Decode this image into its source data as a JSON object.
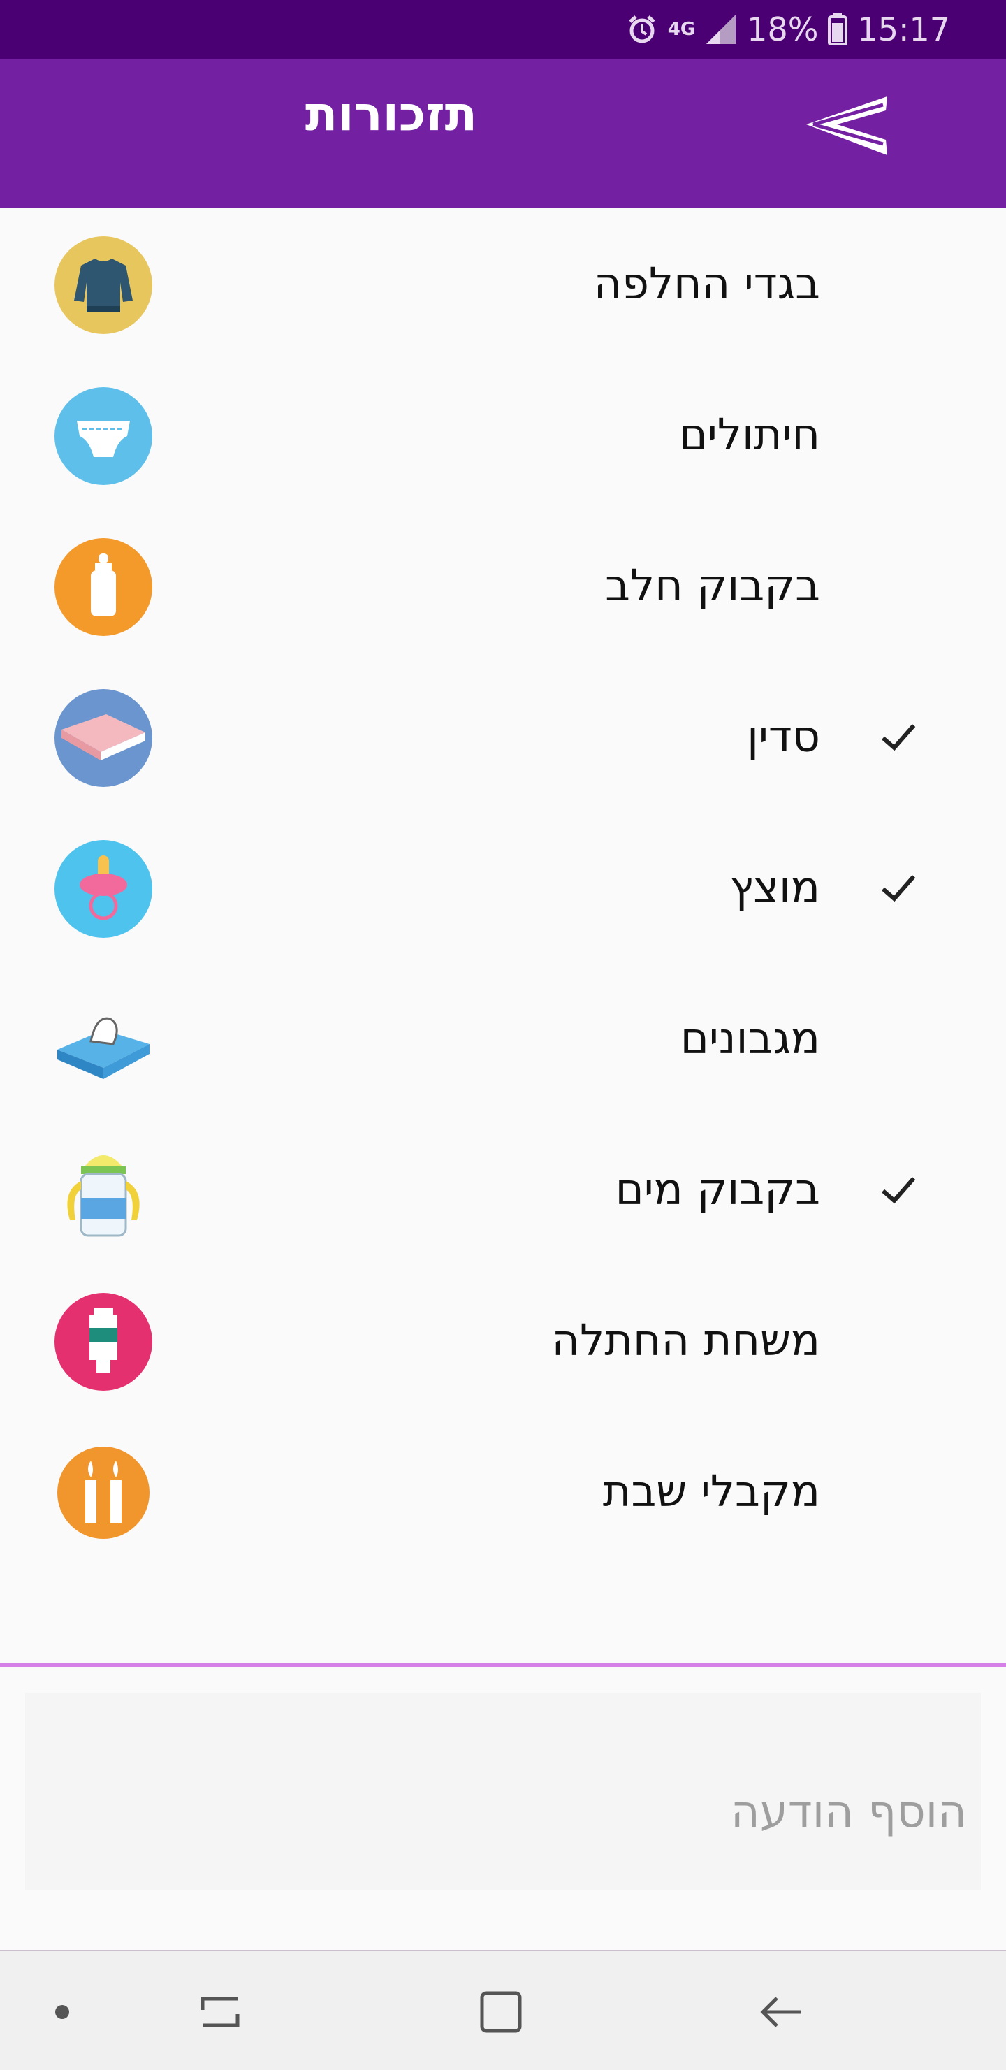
{
  "status_bar": {
    "network": "4G",
    "battery": "18%",
    "time": "15:17"
  },
  "app_bar": {
    "title": "תזכורות"
  },
  "items": [
    {
      "label": "בגדי החלפה",
      "checked": false,
      "icon": "sweater-icon"
    },
    {
      "label": "חיתולים",
      "checked": false,
      "icon": "diaper-icon"
    },
    {
      "label": "בקבוק חלב",
      "checked": false,
      "icon": "milk-bottle-icon"
    },
    {
      "label": "סדין",
      "checked": true,
      "icon": "sheet-icon"
    },
    {
      "label": "מוצץ",
      "checked": true,
      "icon": "pacifier-icon"
    },
    {
      "label": "מגבונים",
      "checked": false,
      "icon": "wipes-icon"
    },
    {
      "label": "בקבוק מים",
      "checked": true,
      "icon": "sippy-cup-icon"
    },
    {
      "label": "משחת החתלה",
      "checked": false,
      "icon": "cream-tube-icon"
    },
    {
      "label": "מקבלי שבת",
      "checked": false,
      "icon": "candles-icon"
    }
  ],
  "message": {
    "placeholder": "הוסף הודעה"
  },
  "colors": {
    "status_bar": "#4a0072",
    "app_bar": "#7420a2",
    "divider": "#d580e6"
  }
}
